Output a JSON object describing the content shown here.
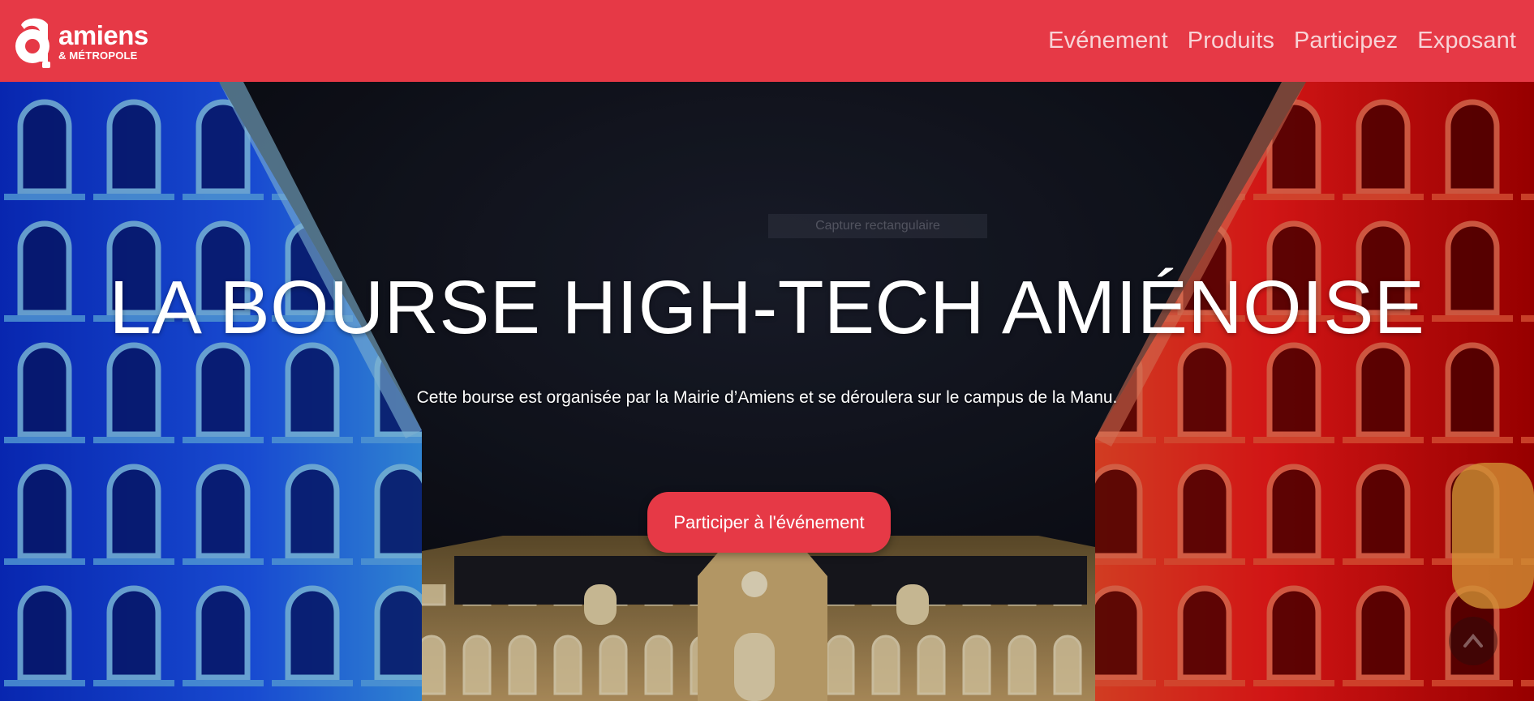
{
  "header": {
    "logo": {
      "mark": "a",
      "word": "amiens",
      "sub": "& MÉTROPOLE"
    },
    "nav": [
      {
        "label": "Evénement"
      },
      {
        "label": "Produits"
      },
      {
        "label": "Participez"
      },
      {
        "label": "Exposant"
      }
    ]
  },
  "hero": {
    "title": "LA BOURSE HIGH-TECH AMIÉNOISE",
    "subtitle": "Cette bourse est organisée par la Mairie d’Amiens et se déroulera sur le campus de la Manu.",
    "cta_label": "Participer à l'événement",
    "ghost_tooltip": "Capture rectangulaire"
  },
  "colors": {
    "brand": "#e63946",
    "nav_text": "#f8d3d6",
    "hero_text": "#ffffff",
    "building_left": "#1e5cff",
    "building_right": "#ff1a1a",
    "courtyard_light": "#f5c36a"
  },
  "icons": [
    "amiens-logo-icon",
    "scroll-to-top-icon"
  ]
}
